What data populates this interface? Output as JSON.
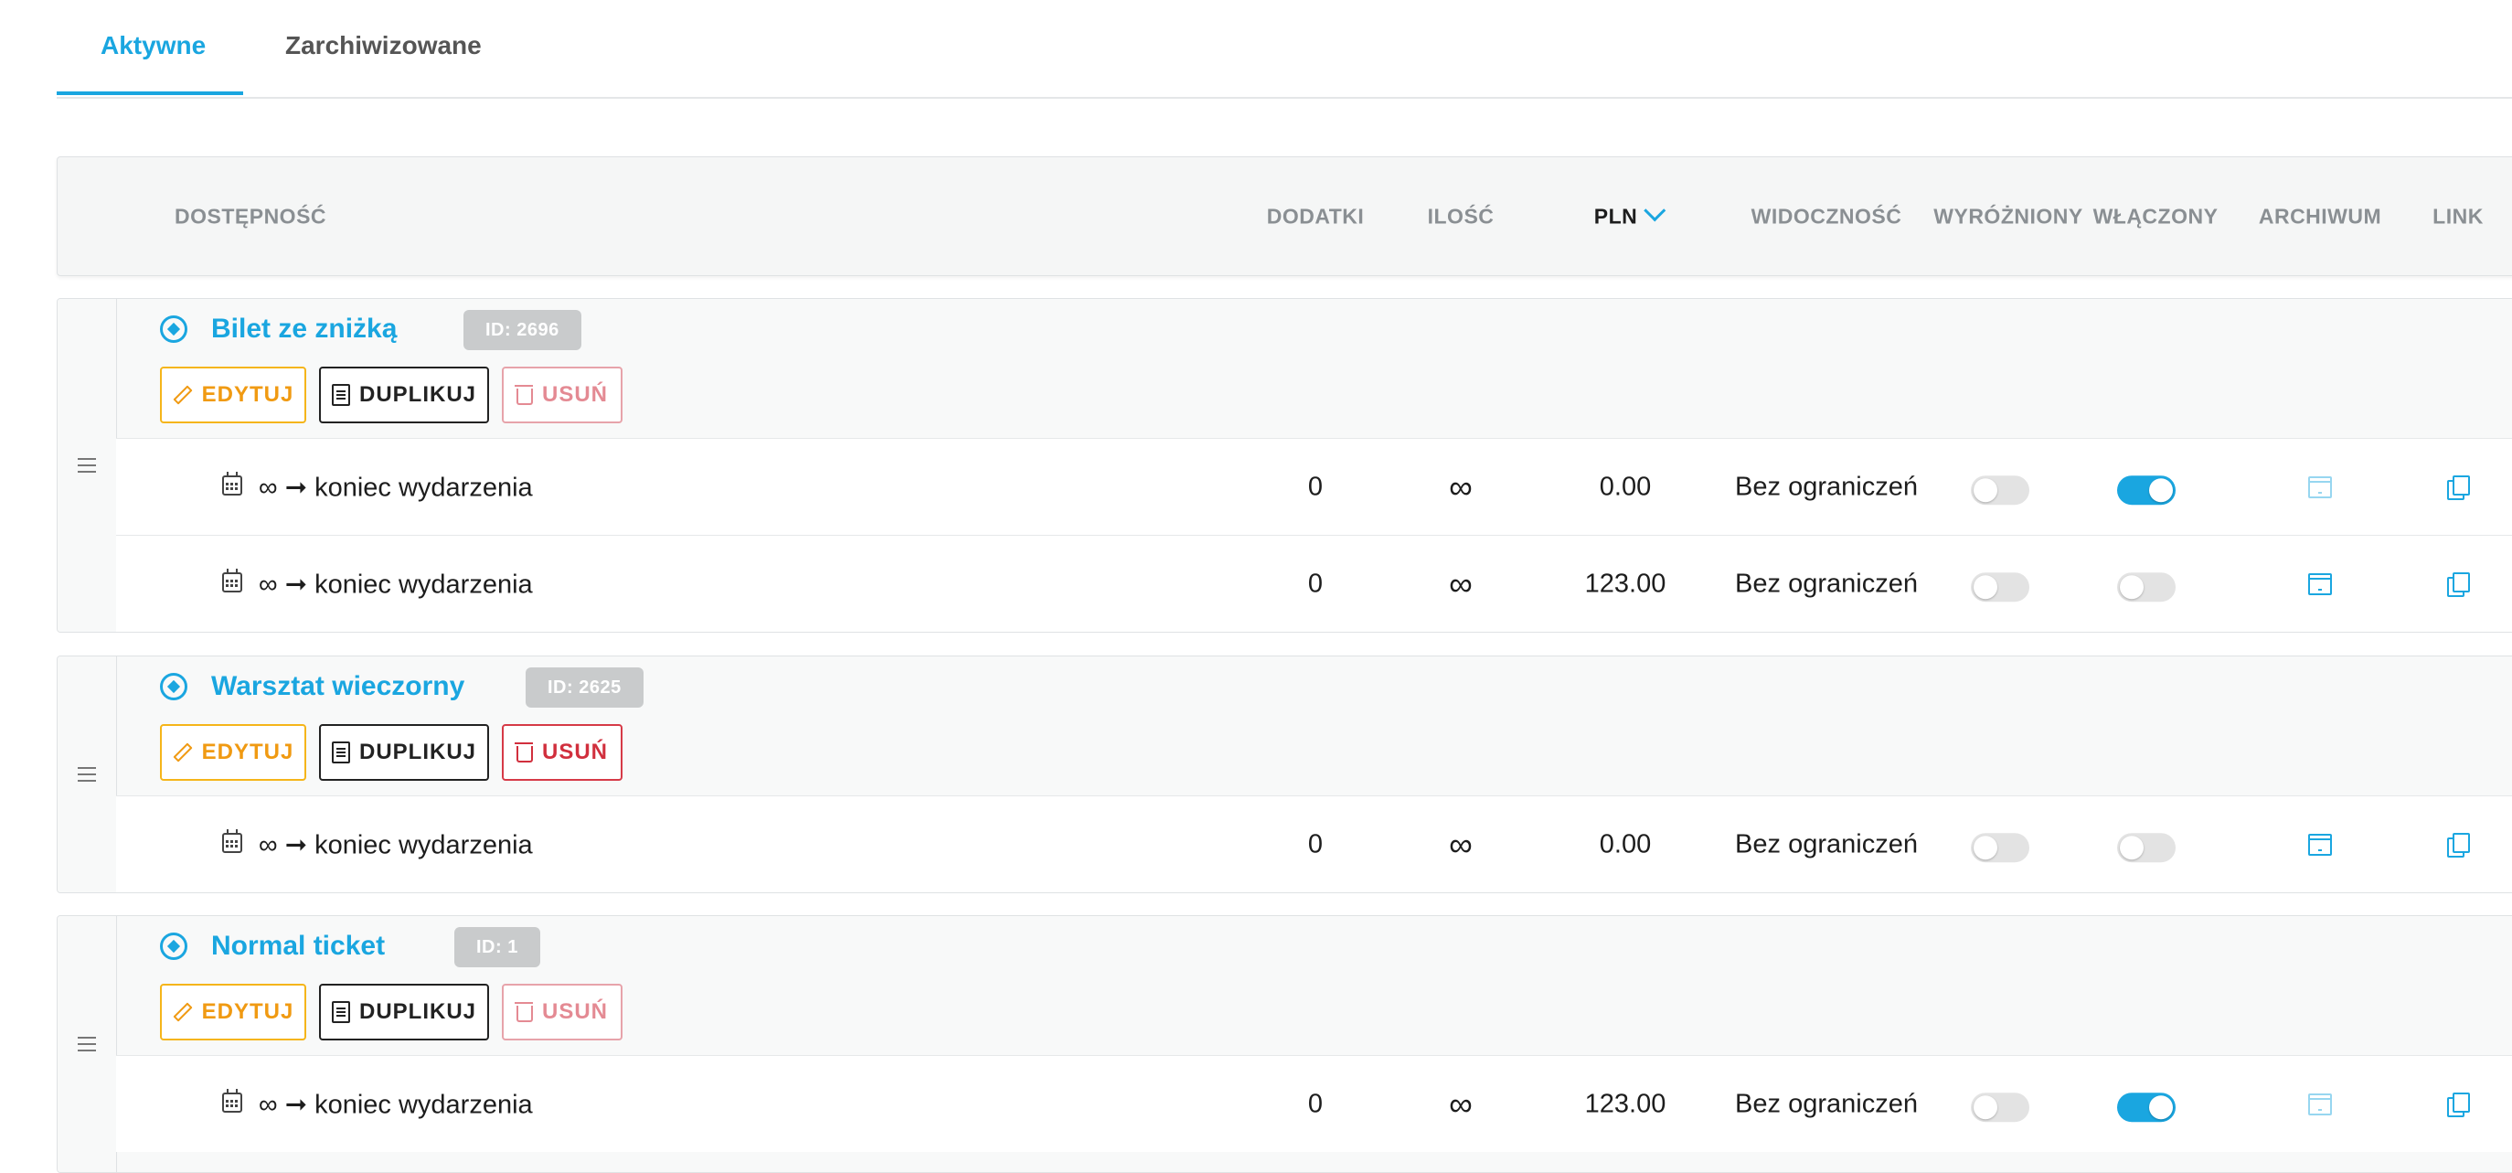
{
  "tabs": [
    {
      "label": "Aktywne",
      "active": true
    },
    {
      "label": "Zarchiwizowane",
      "active": false
    }
  ],
  "columns": {
    "availability": "DOSTĘPNOŚĆ",
    "addons": "DODATKI",
    "quantity": "ILOŚĆ",
    "price": "PLN",
    "visibility": "WIDOCZNOŚĆ",
    "featured": "WYRÓŻNIONY",
    "enabled": "WŁĄCZONY",
    "archive": "ARCHIWUM",
    "link": "LINK"
  },
  "buttons": {
    "edit": "EDYTUJ",
    "duplicate": "DUPLIKUJ",
    "delete": "USUŃ"
  },
  "groups": [
    {
      "title": "Bilet ze zniżką",
      "id_label": "ID: 2696",
      "delete_enabled": false,
      "rows": [
        {
          "availability": "∞ ➞ koniec wydarzenia",
          "addons": "0",
          "quantity": "∞",
          "price": "0.00",
          "visibility": "Bez ograniczeń",
          "featured": false,
          "enabled": true,
          "archive_active": false
        },
        {
          "availability": "∞ ➞ koniec wydarzenia",
          "addons": "0",
          "quantity": "∞",
          "price": "123.00",
          "visibility": "Bez ograniczeń",
          "featured": false,
          "enabled": false,
          "archive_active": true
        }
      ]
    },
    {
      "title": "Warsztat wieczorny",
      "id_label": "ID: 2625",
      "delete_enabled": true,
      "rows": [
        {
          "availability": "∞ ➞ koniec wydarzenia",
          "addons": "0",
          "quantity": "∞",
          "price": "0.00",
          "visibility": "Bez ograniczeń",
          "featured": false,
          "enabled": false,
          "archive_active": true
        }
      ]
    },
    {
      "title": "Normal ticket",
      "id_label": "ID: 1",
      "delete_enabled": false,
      "rows": [
        {
          "availability": "∞ ➞ koniec wydarzenia",
          "addons": "0",
          "quantity": "∞",
          "price": "123.00",
          "visibility": "Bez ograniczeń",
          "featured": false,
          "enabled": true,
          "archive_active": false
        }
      ]
    }
  ],
  "colors": {
    "accent": "#1aa6e0",
    "edit": "#f09a12",
    "delete": "#d12f3d",
    "badge": "#c9cbcc"
  }
}
